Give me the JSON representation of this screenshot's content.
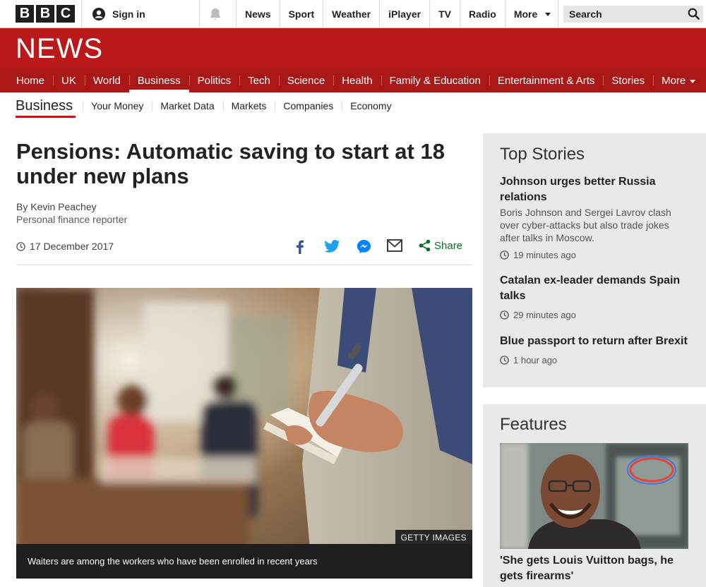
{
  "brand": {
    "letters": [
      "B",
      "B",
      "C"
    ],
    "masthead": "NEWS",
    "accent": "#bb1919"
  },
  "account": {
    "sign_in": "Sign in"
  },
  "top_nav": [
    "News",
    "Sport",
    "Weather",
    "iPlayer",
    "TV",
    "Radio",
    "More"
  ],
  "search": {
    "placeholder": "Search"
  },
  "main_nav": [
    "Home",
    "UK",
    "World",
    "Business",
    "Politics",
    "Tech",
    "Science",
    "Health",
    "Family & Education",
    "Entertainment & Arts",
    "Stories",
    "More"
  ],
  "main_nav_active": "Business",
  "section_nav": {
    "title": "Business",
    "items": [
      "Your Money",
      "Market Data",
      "Markets",
      "Companies",
      "Economy"
    ]
  },
  "article": {
    "headline": "Pensions: Automatic saving to start at 18 under new plans",
    "author": "By Kevin Peachey",
    "role": "Personal finance reporter",
    "date": "17 December 2017",
    "share_label": "Share",
    "image_credit": "GETTY IMAGES",
    "image_caption": "Waiters are among the workers who have been enrolled in recent years"
  },
  "top_stories": {
    "title": "Top Stories",
    "items": [
      {
        "title": "Johnson urges better Russia relations",
        "summary": "Boris Johnson and Sergei Lavrov clash over cyber-attacks but also trade jokes after talks in Moscow.",
        "time": "19 minutes ago"
      },
      {
        "title": "Catalan ex-leader demands Spain talks",
        "summary": "",
        "time": "29 minutes ago"
      },
      {
        "title": "Blue passport to return after Brexit",
        "summary": "",
        "time": "1 hour ago"
      }
    ]
  },
  "features": {
    "title": "Features",
    "items": [
      {
        "title": "'She gets Louis Vuitton bags, he gets firearms'"
      }
    ]
  },
  "icons": [
    "bbc-logo",
    "user-icon",
    "bell-icon",
    "chevron-down-icon",
    "search-icon",
    "clock-icon",
    "facebook-icon",
    "twitter-icon",
    "messenger-icon",
    "email-icon",
    "share-icon"
  ]
}
